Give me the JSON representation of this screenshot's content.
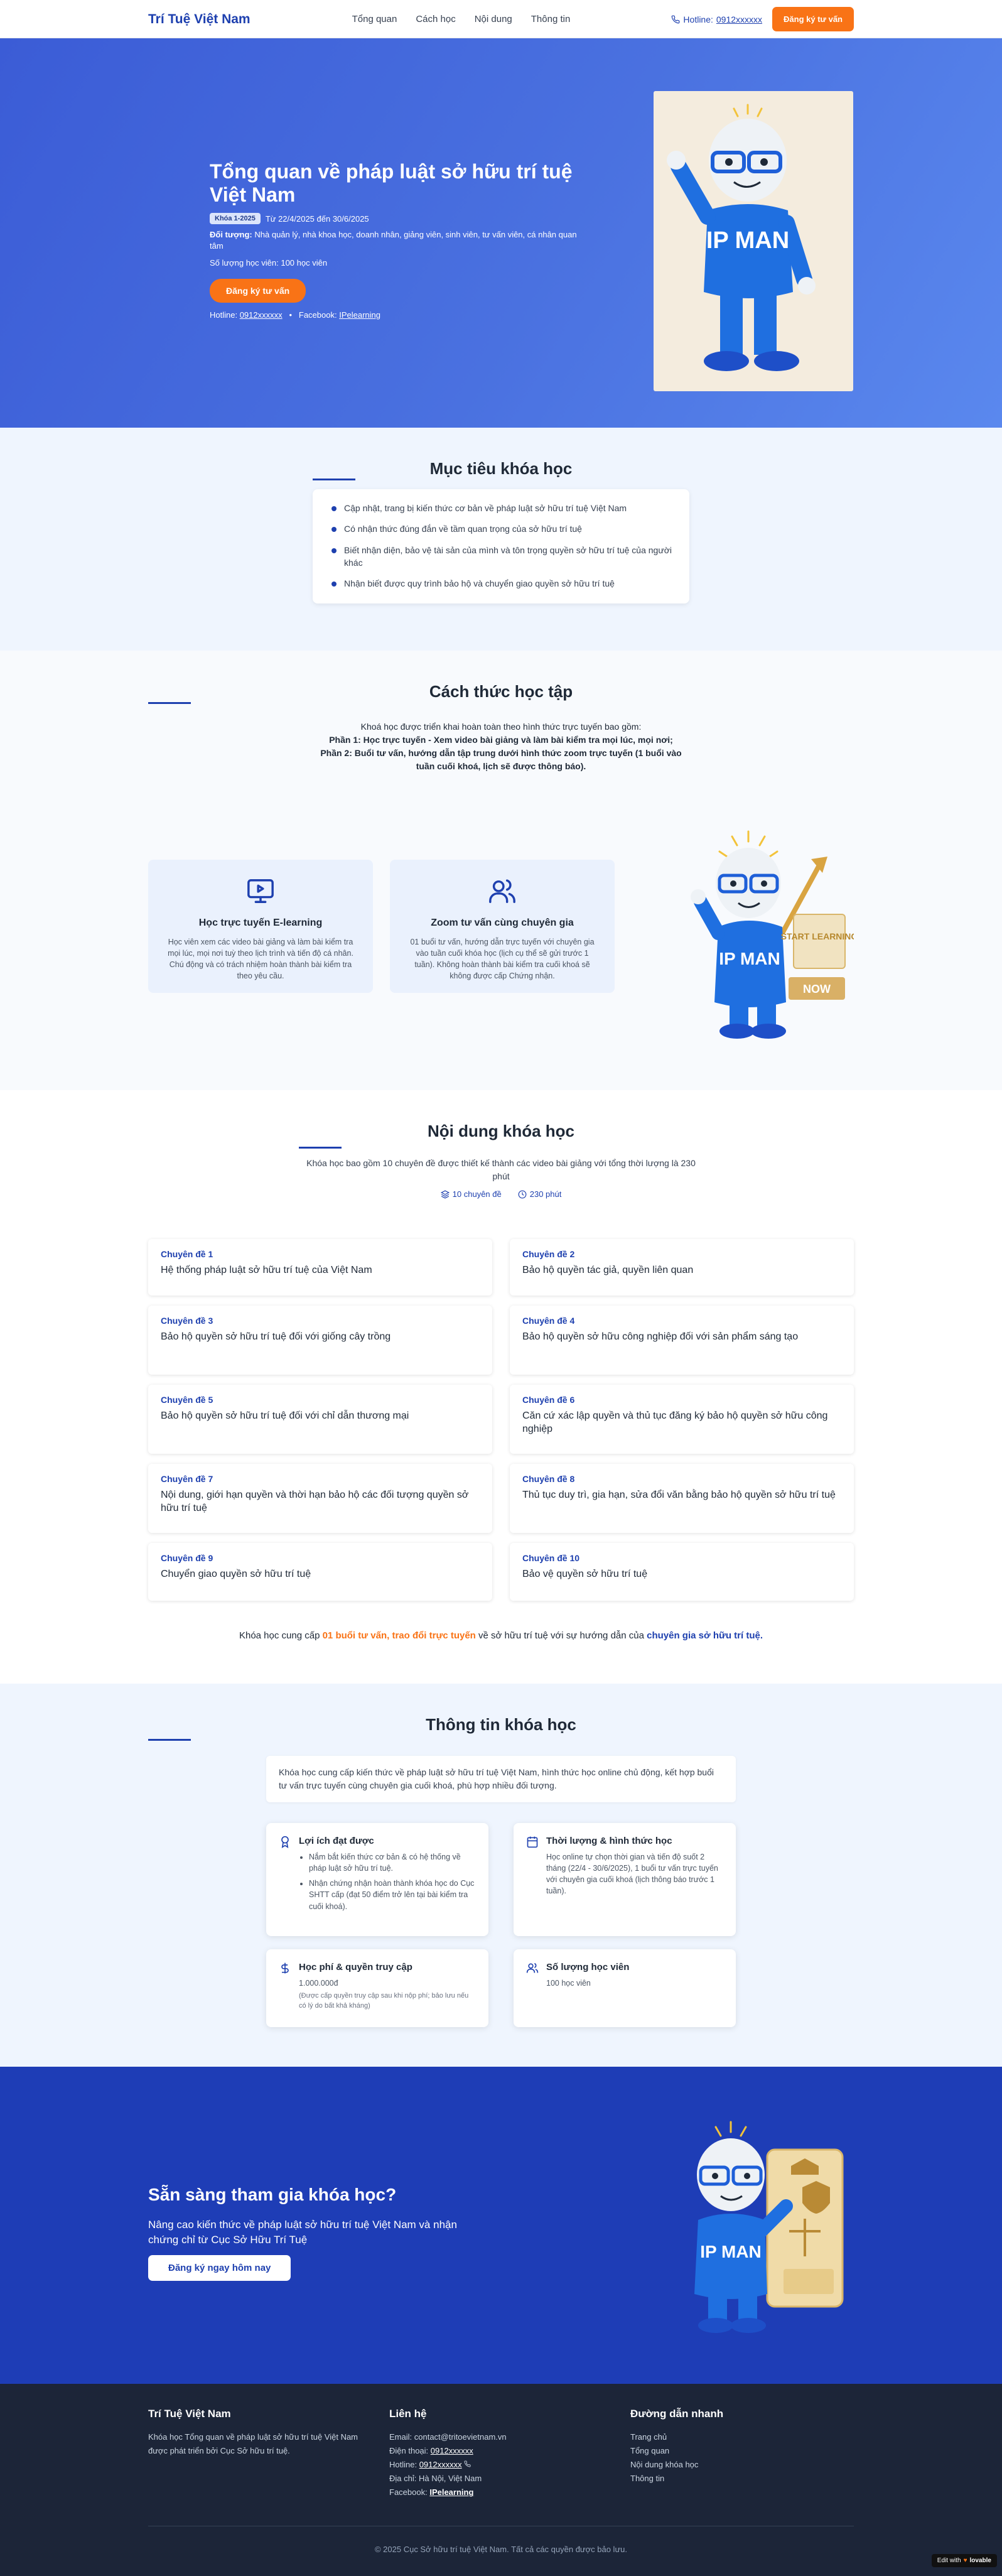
{
  "nav": {
    "brand": "Trí Tuệ Việt Nam",
    "menu": [
      "Tổng quan",
      "Cách học",
      "Nội dung",
      "Thông tin"
    ],
    "hotline_label": "Hotline:",
    "hotline_number": "0912xxxxxx",
    "cta": "Đăng ký tư vấn"
  },
  "hero": {
    "title": "Tổng quan về pháp luật sở hữu trí tuệ Việt Nam",
    "badge": "Khóa 1-2025",
    "dates": "Từ 22/4/2025 đến 30/6/2025",
    "audience_label": "Đối tượng:",
    "audience": "Nhà quản lý, nhà khoa học, doanh nhân, giảng viên, sinh viên, tư vấn viên, cá nhân quan tâm",
    "students": "Số lượng học viên: 100 học viên",
    "button": "Đăng ký tư vấn",
    "hotline_label": "Hotline:",
    "hotline": "0912xxxxxx",
    "sep": "•",
    "facebook_label": "Facebook:",
    "facebook": "IPelearning",
    "mascot_shirt": "IP MAN"
  },
  "goals": {
    "title": "Mục tiêu khóa học",
    "items": [
      "Cập nhật, trang bị kiến thức cơ bản về pháp luật sở hữu trí tuệ Việt Nam",
      "Có nhận thức đúng đắn về tầm quan trọng của sở hữu trí tuệ",
      "Biết nhận diện, bảo vệ tài sản của mình và tôn trọng quyền sở hữu trí tuệ của người khác",
      "Nhận biết được quy trình bảo hộ và chuyển giao quyền sở hữu trí tuệ"
    ]
  },
  "learning": {
    "title": "Cách thức học tập",
    "intro": "Khoá học được triển khai hoàn toàn theo hình thức trực tuyến bao gồm:",
    "part1": "Phần 1: Học trực tuyến - Xem video bài giảng và làm bài kiểm tra mọi lúc, mọi nơi;",
    "part2": "Phần 2: Buổi tư vấn, hướng dẫn tập trung dưới hình thức zoom trực tuyến (1 buổi vào tuần cuối khoá, lịch sẽ được thông báo).",
    "cards": [
      {
        "title": "Học trực tuyến E-learning",
        "desc": "Học viên xem các video bài giảng và làm bài kiểm tra mọi lúc, mọi nơi tuỳ theo lịch trình và tiến độ cá nhân. Chú động và có trách nhiệm hoàn thành bài kiểm tra theo yêu cầu."
      },
      {
        "title": "Zoom tư vấn cùng chuyên gia",
        "desc": "01 buổi tư vấn, hướng dẫn trực tuyến với chuyên gia vào tuần cuối khóa học (lịch cụ thể sẽ gửi trước 1 tuần). Không hoàn thành bài kiểm tra cuối khoá sẽ không được cấp Chứng nhận."
      }
    ],
    "mascot_shirt": "IP MAN",
    "sign": "START LEARNING",
    "now": "NOW"
  },
  "content": {
    "title": "Nội dung khóa học",
    "intro": "Khóa học bao gồm 10 chuyên đề được thiết kế thành các video bài giảng với tổng thời lượng là 230 phút",
    "stat_topics": "10 chuyên đề",
    "stat_minutes": "230 phút",
    "topics": [
      {
        "label": "Chuyên đề 1",
        "title": "Hệ thống pháp luật sở hữu trí tuệ của Việt Nam"
      },
      {
        "label": "Chuyên đề 2",
        "title": "Bảo hộ quyền tác giả, quyền liên quan"
      },
      {
        "label": "Chuyên đề 3",
        "title": "Bảo hộ quyền sở hữu trí tuệ đối với giống cây trồng"
      },
      {
        "label": "Chuyên đề 4",
        "title": "Bảo hộ quyền sở hữu công nghiệp đối với sản phẩm sáng tạo"
      },
      {
        "label": "Chuyên đề 5",
        "title": "Bảo hộ quyền sở hữu trí tuệ đối với chỉ dẫn thương mại"
      },
      {
        "label": "Chuyên đề 6",
        "title": "Căn cứ xác lập quyền và thủ tục đăng ký bảo hộ quyền sở hữu công nghiệp"
      },
      {
        "label": "Chuyên đề 7",
        "title": "Nội dung, giới hạn quyền và thời hạn bảo hộ các đối tượng quyền sở hữu trí tuệ"
      },
      {
        "label": "Chuyên đề 8",
        "title": "Thủ tục duy trì, gia hạn, sửa đổi văn bằng bảo hộ quyền sở hữu trí tuệ"
      },
      {
        "label": "Chuyên đề 9",
        "title": "Chuyển giao quyền sở hữu trí tuệ"
      },
      {
        "label": "Chuyên đề 10",
        "title": "Bảo vệ quyền sở hữu trí tuệ"
      }
    ],
    "foot_1": "Khóa học cung cấp ",
    "foot_highlight": "01 buổi tư vấn, trao đổi trực tuyến",
    "foot_2": " về sở hữu trí tuệ với sự hướng dẫn của ",
    "foot_expert": "chuyên gia sở hữu trí tuệ."
  },
  "info": {
    "title": "Thông tin khóa học",
    "intro": "Khóa học cung cấp kiến thức về pháp luật sở hữu trí tuệ Việt Nam, hình thức học online chủ động, kết hợp buổi tư vấn trực tuyến cùng chuyên gia cuối khoá, phù hợp nhiều đối tượng.",
    "benefits_title": "Lợi ích đạt được",
    "benefits": [
      "Nắm bắt kiến thức cơ bản & có hệ thống về pháp luật sở hữu trí tuệ.",
      "Nhận chứng nhận hoàn thành khóa học do Cục SHTT cấp (đạt 50 điểm trở lên tại bài kiểm tra cuối khoá)."
    ],
    "time_title": "Thời lượng & hình thức học",
    "time_desc": "Học online tự chọn thời gian và tiến độ suốt 2 tháng (22/4 - 30/6/2025), 1 buổi tư vấn trực tuyến với chuyên gia cuối khoá (lịch thông báo trước 1 tuần).",
    "fee_title": "Học phí & quyền truy cập",
    "fee": "1.000.000đ",
    "fee_note": "(Được cấp quyền truy cập sau khi nộp phí; bảo lưu nếu có lý do bất khả kháng)",
    "count_title": "Số lượng học viên",
    "count": "100 học viên"
  },
  "cta": {
    "title": "Sẵn sàng tham gia khóa học?",
    "desc": "Nâng cao kiến thức về pháp luật sở hữu trí tuệ Việt Nam và nhận chứng chỉ từ Cục Sở Hữu Trí Tuệ",
    "button": "Đăng ký ngay hôm nay",
    "mascot_shirt": "IP MAN"
  },
  "footer": {
    "about_title": "Trí Tuệ Việt Nam",
    "about_text": "Khóa học Tổng quan về pháp luật sở hữu trí tuệ Việt Nam được phát triển bởi Cục Sở hữu trí tuệ.",
    "contact_title": "Liên hệ",
    "email_label": "Email:",
    "email": "contact@tritoevietnam.vn",
    "phone_label": "Điện thoại:",
    "phone": "0912xxxxxx",
    "hotline_label": "Hotline:",
    "hotline": "0912xxxxxx",
    "address_label": "Địa chỉ:",
    "address": "Hà Nội, Việt Nam",
    "facebook_label": "Facebook:",
    "facebook": "IPelearning",
    "links_title": "Đường dẫn nhanh",
    "links": [
      "Trang chủ",
      "Tổng quan",
      "Nội dung khóa học",
      "Thông tin"
    ],
    "copyright": "© 2025 Cục Sở hữu trí tuệ Việt Nam. Tất cả các quyền được bảo lưu.",
    "edit_badge": "Edit with",
    "edit_brand": "lovable"
  }
}
